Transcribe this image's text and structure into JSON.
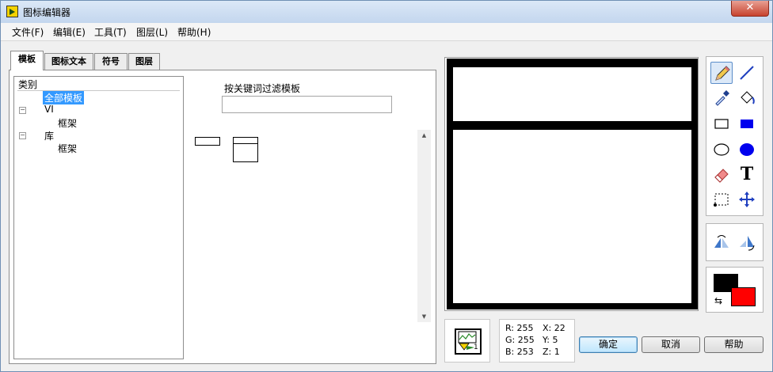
{
  "window": {
    "title": "图标编辑器",
    "close_label": "✕"
  },
  "menu": [
    "文件(F)",
    "编辑(E)",
    "工具(T)",
    "图层(L)",
    "帮助(H)"
  ],
  "tabs": [
    "模板",
    "图标文本",
    "符号",
    "图层"
  ],
  "tree": {
    "header": "类别",
    "items": [
      {
        "label": "全部模板",
        "selected": true
      },
      {
        "label": "VI",
        "expander": "−"
      },
      {
        "label": "框架"
      },
      {
        "label": "库",
        "expander": "−"
      },
      {
        "label": "框架"
      }
    ]
  },
  "filter": {
    "label": "按关键词过滤模板",
    "value": ""
  },
  "tools": [
    {
      "icon": "pencil-icon"
    },
    {
      "icon": "line-icon"
    },
    {
      "icon": "dropper-icon"
    },
    {
      "icon": "fill-bucket-icon"
    },
    {
      "icon": "rectangle-icon"
    },
    {
      "icon": "filled-rectangle-icon"
    },
    {
      "icon": "ellipse-icon"
    },
    {
      "icon": "filled-ellipse-icon"
    },
    {
      "icon": "eraser-icon"
    },
    {
      "icon": "text-icon",
      "glyph": "T"
    },
    {
      "icon": "select-icon"
    },
    {
      "icon": "move-icon"
    }
  ],
  "colors": {
    "foreground": "#000000",
    "background": "#ff0000",
    "swap": "⇆"
  },
  "preview": {
    "number": "1"
  },
  "info": {
    "r": "R: 255",
    "g": "G: 255",
    "b": "B: 253",
    "x": "X: 22",
    "y": "Y: 5",
    "z": "Z: 1"
  },
  "buttons": {
    "ok": "确定",
    "cancel": "取消",
    "help": "帮助"
  },
  "scroll": {
    "up": "▲",
    "down": "▼"
  }
}
